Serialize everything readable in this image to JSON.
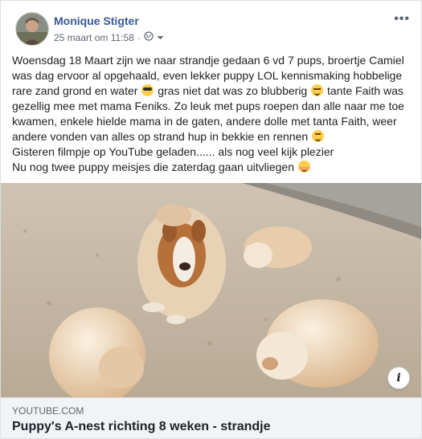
{
  "post": {
    "author": "Monique Stigter",
    "timestamp": "25 maart om 11:58",
    "separator": "·",
    "privacy_icon": "globe-icon",
    "more_label": "•••",
    "text_lines": [
      "Woensdag 18 Maart zijn we naar strandje gedaan 6 vd 7 pups, broertje Camiel",
      "was dag ervoor al opgehaald, even lekker puppy LOL kennismaking hobbelige",
      "rare zand grond en water",
      " gras niet dat was zo blubberig ",
      " tante Faith was",
      "gezellig mee met mama Feniks. Zo leuk met pups roepen dan alle naar me toe",
      "kwamen, enkele hielde mama in de gaten, andere dolle met tanta Faith, weer",
      "andere vonden van alles op strand hup in bekkie en rennen ",
      "Gisteren filmpje op YouTube geladen...... als nog veel kijk plezier",
      "Nu nog twee puppy meisjes die zaterdag gaan uitvliegen "
    ],
    "emojis": [
      "sunglasses-emoji",
      "sweat-emoji",
      "grin-emoji",
      "blush-emoji"
    ]
  },
  "link_preview": {
    "domain": "YOUTUBE.COM",
    "title": "Puppy's A-nest richting 8 weken - strandje",
    "info_label": "i"
  },
  "colors": {
    "author": "#385898",
    "text": "#1c1e21",
    "meta": "#606770",
    "link_bg": "#f2f3f5"
  }
}
